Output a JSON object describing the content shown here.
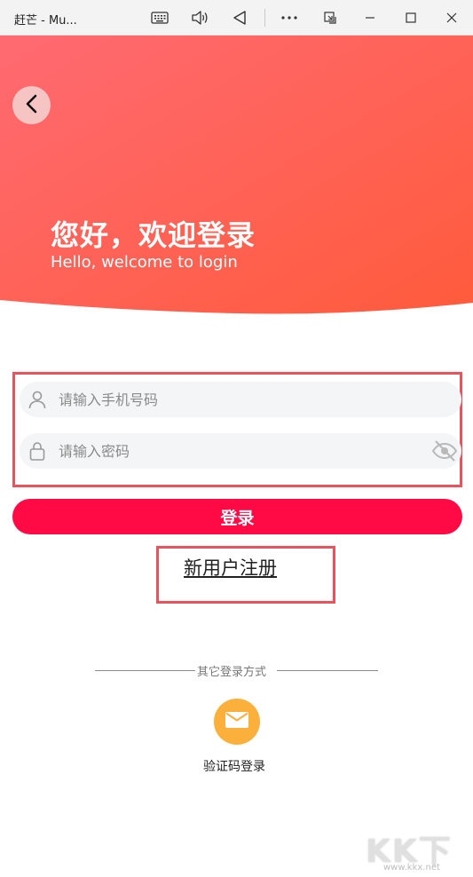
{
  "window": {
    "title": "赶芒 - Mu..."
  },
  "header": {
    "title": "您好，欢迎登录",
    "subtitle": "Hello, welcome to login"
  },
  "form": {
    "phone_placeholder": "请输入手机号码",
    "password_placeholder": "请输入密码",
    "login_label": "登录",
    "register_label": "新用户注册"
  },
  "other": {
    "divider_text": "其它登录方式",
    "sms_login_label": "验证码登录"
  },
  "watermark": {
    "big": "KK下载",
    "small": "www.kkx.net"
  },
  "colors": {
    "gradient_start": "#ff6a72",
    "gradient_end": "#ff5b3c",
    "primary": "#ff0a45",
    "annotation_box": "#e8545e",
    "sms_icon": "#fbb03b"
  },
  "icons": {
    "back": "chevron-left-icon",
    "phone": "user-icon",
    "password": "lock-icon",
    "visibility": "eye-off-icon",
    "sms": "mail-icon"
  }
}
